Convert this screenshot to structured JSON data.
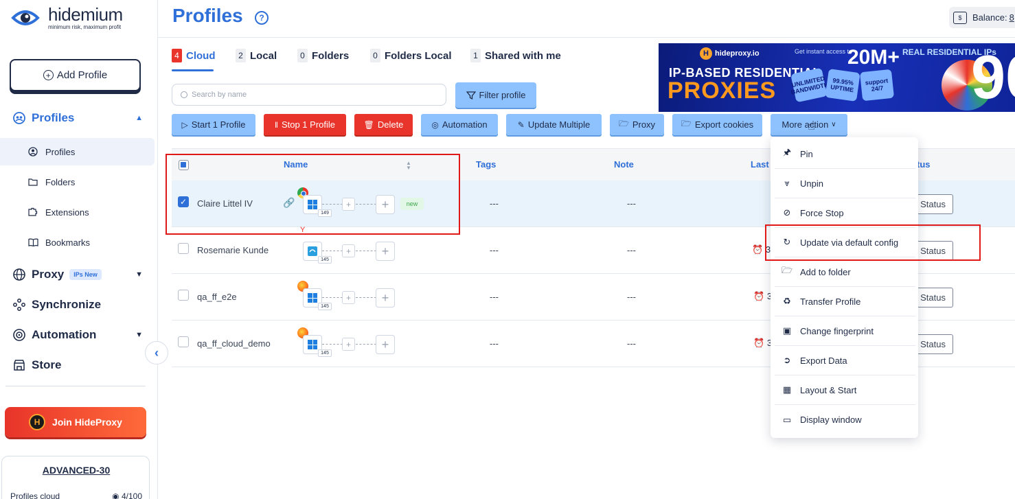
{
  "brand": {
    "name": "hidemium",
    "tagline": "minimum risk, maximum profit"
  },
  "sidebar": {
    "add_profile": "Add Profile",
    "profiles": "Profiles",
    "sub_items": [
      "Profiles",
      "Folders",
      "Extensions",
      "Bookmarks"
    ],
    "proxy": "Proxy",
    "proxy_badge": "IPs New",
    "synchronize": "Synchronize",
    "automation": "Automation",
    "store": "Store",
    "join_label": "Join HideProxy",
    "plan_name": "ADVANCED-30",
    "plan_row_label": "Profiles cloud",
    "plan_row_value": "4/100"
  },
  "header": {
    "title": "Profiles",
    "balance_label": "Balance:",
    "balance_value": "8"
  },
  "tabs": [
    {
      "count": "4",
      "label": "Cloud",
      "active": true
    },
    {
      "count": "2",
      "label": "Local"
    },
    {
      "count": "0",
      "label": "Folders"
    },
    {
      "count": "0",
      "label": "Folders Local"
    },
    {
      "count": "1",
      "label": "Shared with me"
    }
  ],
  "banner": {
    "logo": "hideproxy.io",
    "access": "Get instant access to",
    "big": "20M+",
    "real": "REAL RESIDENTIAL IPs",
    "line1": "IP-BASED RESIDENTIAL",
    "line2": "PROXIES",
    "p1": "UNLIMITED BANDWIDTH",
    "p2": "99.95% UPTIME",
    "p3": "support 24/7",
    "nine": "90"
  },
  "toolbar": {
    "search_placeholder": "Search by name",
    "filter": "Filter profile",
    "start": "Start 1 Profile",
    "stop": "Stop 1 Profile",
    "delete": "Delete",
    "automation": "Automation",
    "update_multiple": "Update Multiple",
    "proxy": "Proxy",
    "export_cookies": "Export cookies",
    "more_action": "More action"
  },
  "table": {
    "headers": {
      "name": "Name",
      "tags": "Tags",
      "note": "Note",
      "last": "Last",
      "status": "tus"
    },
    "rows": [
      {
        "name": "Claire Littel IV",
        "browser": "chrome",
        "version": "149",
        "tags": "---",
        "note": "---",
        "badge": "new",
        "status": "Status",
        "last": ""
      },
      {
        "name": "Rosemarie Kunde",
        "browser": "edge",
        "version": "145",
        "tags": "---",
        "note": "---",
        "status": "Status",
        "last": "3"
      },
      {
        "name": "qa_ff_e2e",
        "browser": "firefox",
        "version": "145",
        "tags": "---",
        "note": "---",
        "status": "Status",
        "last": "3"
      },
      {
        "name": "qa_ff_cloud_demo",
        "browser": "firefox",
        "version": "145",
        "tags": "---",
        "note": "---",
        "status": "Status",
        "last": "3"
      }
    ]
  },
  "menu": {
    "items": [
      "Pin",
      "Unpin",
      "Force Stop",
      "Update via default config",
      "Add to folder",
      "Transfer Profile",
      "Change fingerprint",
      "Export Data",
      "Layout & Start",
      "Display window"
    ]
  }
}
